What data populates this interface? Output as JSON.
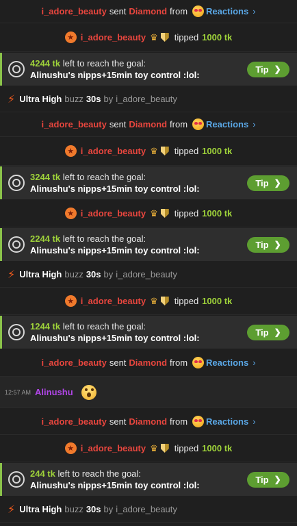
{
  "user": "i_adore_beauty",
  "gift": {
    "sent": "sent",
    "item": "Diamond",
    "from": "from",
    "reactions": "Reactions"
  },
  "tip": {
    "tipped": "tipped",
    "amount": "1000 tk"
  },
  "goal": {
    "left_text": "left to reach the goal:",
    "title": "Alinushu's nipps+15min toy control :lol:",
    "button": "Tip",
    "amounts": [
      "4244 tk",
      "3244 tk",
      "2244 tk",
      "1244 tk",
      "244 tk"
    ]
  },
  "buzz": {
    "level": "Ultra High",
    "word": "buzz",
    "duration": "30s",
    "by": "by"
  },
  "message": {
    "time": "12:57 AM",
    "author": "Alinushu"
  },
  "icons": {
    "gift_emoji": "heart-eyes-emoji-icon",
    "tipper_badge": "star-badge-icon",
    "crown": "crown-icon",
    "shield": "shield-icon",
    "goal": "target-icon",
    "buzz": "lightning-icon",
    "reaction": "surprised-emoji-icon"
  },
  "colors": {
    "user": "#e8463e",
    "reactions": "#5aa7e6",
    "tokens": "#9fd33a",
    "tip_button": "#5d9e31",
    "author": "#b146e8",
    "buzz": "#f25a1c"
  }
}
